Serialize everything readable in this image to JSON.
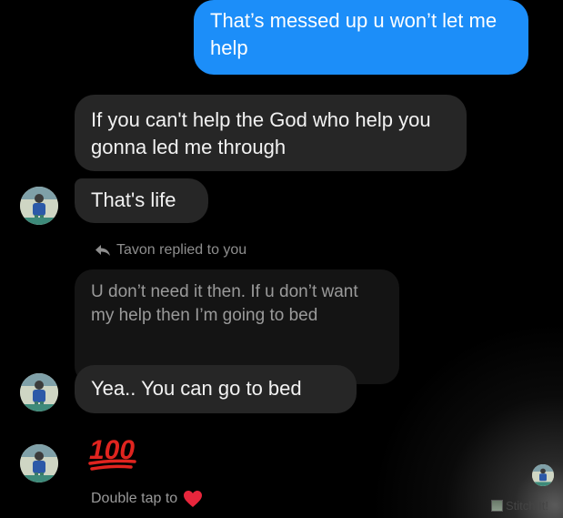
{
  "messages": {
    "outgoing_1": "That’s messed up u won’t let me help",
    "incoming_1": "If you can't help the God who help you gonna led me through",
    "incoming_2": "That's life",
    "reply_label": "Tavon replied to you",
    "quoted": "U don’t need it then. If u don’t want my help then I’m going to bed",
    "incoming_3": "Yea.. You can go to bed",
    "incoming_4_emoji": "100"
  },
  "double_tap": {
    "label": "Double tap to"
  },
  "watermark": {
    "label": "Stitch It!"
  },
  "colors": {
    "outgoing_bubble": "#1c8ef9",
    "incoming_bubble": "#262626",
    "quoted_bubble": "#141414",
    "heart": "#e8263c",
    "emoji_100": "#e0241f"
  },
  "icons": {
    "reply": "reply-arrow-icon",
    "heart": "heart-icon",
    "avatar": "avatar",
    "emoji": "hundred-points-emoji-icon"
  }
}
